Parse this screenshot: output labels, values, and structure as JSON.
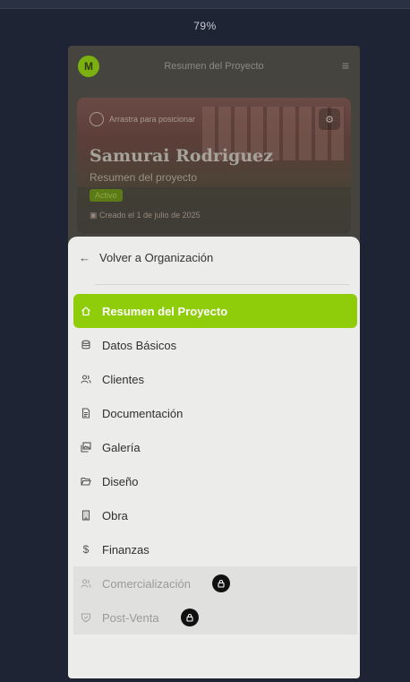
{
  "zoom_level": "79%",
  "app": {
    "avatar_initial": "M",
    "title": "Resumen del Proyecto",
    "menu_icon": "hamburger-icon"
  },
  "cover": {
    "drag_hint": "Arrastra para posicionar",
    "name": "Samurai Rodriguez",
    "subtitle": "Resumen del proyecto",
    "status": "Activo",
    "created": "Creado el 1 de julio de 2025"
  },
  "sheet": {
    "back_label": "Volver a Organización",
    "items": [
      {
        "label": "Resumen del Proyecto",
        "icon": "home-icon",
        "active": true,
        "locked": false
      },
      {
        "label": "Datos Básicos",
        "icon": "database-icon",
        "active": false,
        "locked": false
      },
      {
        "label": "Clientes",
        "icon": "users-icon",
        "active": false,
        "locked": false
      },
      {
        "label": "Documentación",
        "icon": "file-text-icon",
        "active": false,
        "locked": false
      },
      {
        "label": "Galería",
        "icon": "images-icon",
        "active": false,
        "locked": false
      },
      {
        "label": "Diseño",
        "icon": "folder-open-icon",
        "active": false,
        "locked": false
      },
      {
        "label": "Obra",
        "icon": "building-icon",
        "active": false,
        "locked": false
      },
      {
        "label": "Finanzas",
        "icon": "dollar-icon",
        "active": false,
        "locked": false
      },
      {
        "label": "Comercialización",
        "icon": "users-icon",
        "active": false,
        "locked": true
      },
      {
        "label": "Post-Venta",
        "icon": "shield-icon",
        "active": false,
        "locked": true
      }
    ]
  },
  "colors": {
    "accent": "#8fcc0a",
    "page_bg": "#1e2433",
    "sheet_bg": "#ececea"
  }
}
